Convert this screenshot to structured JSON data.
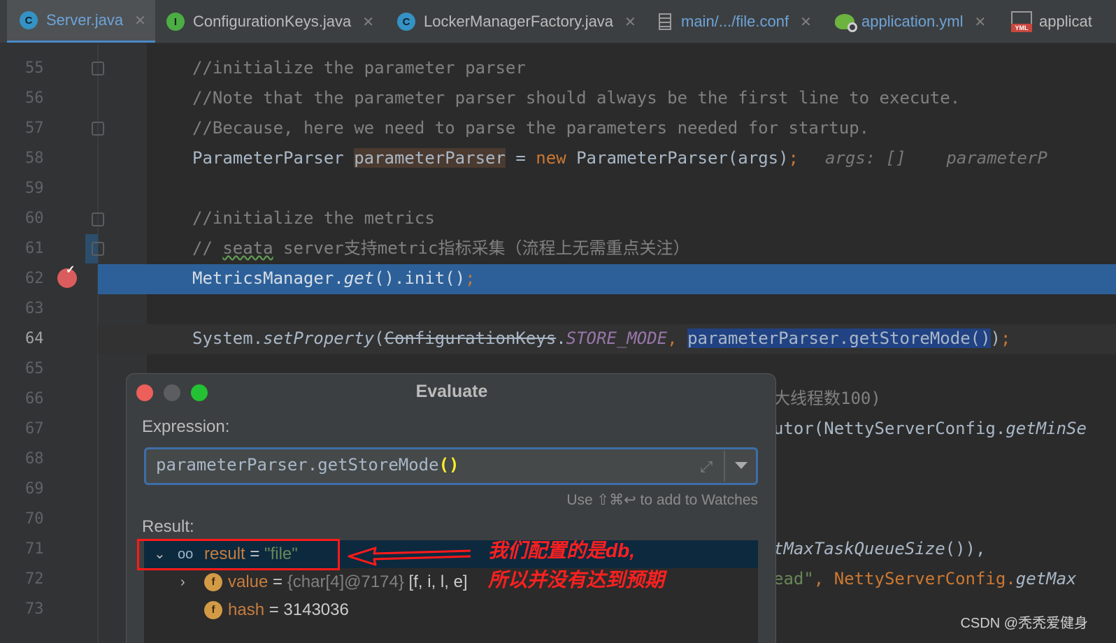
{
  "tabs": [
    {
      "label": "Server.java",
      "icon": "C",
      "icon_name": "class-icon",
      "active": true
    },
    {
      "label": "ConfigurationKeys.java",
      "icon": "I",
      "icon_name": "interface-icon"
    },
    {
      "label": "LockerManagerFactory.java",
      "icon": "C",
      "icon_name": "class-icon"
    },
    {
      "label": "main/.../file.conf",
      "icon_name": "text-file-icon"
    },
    {
      "label": "application.yml",
      "icon_name": "spring-config-icon"
    },
    {
      "label": "applicat",
      "icon_name": "yml-file-icon"
    }
  ],
  "line_numbers": [
    "55",
    "56",
    "57",
    "58",
    "59",
    "60",
    "61",
    "62",
    "63",
    "64",
    "65",
    "66",
    "67",
    "68",
    "69",
    "70",
    "71",
    "72",
    "73"
  ],
  "code": {
    "l55": "//initialize the parameter parser",
    "l56": "//Note that the parameter parser should always be the first line to execute.",
    "l57": "//Because, here we need to parse the parameters needed for startup.",
    "l58_type": "ParameterParser ",
    "l58_var": "parameterParser",
    "l58_eq": " = ",
    "l58_new": "new",
    "l58_ctor": " ParameterParser(args)",
    "l58_semi": ";",
    "l58_hint": "args: []    parameterP",
    "l60": "//initialize the metrics",
    "l61_a": "// ",
    "l61_b": "seata",
    "l61_c": " server支持metric指标采集（流程上无需重点关注）",
    "l62_a": "MetricsManager.",
    "l62_b": "get",
    "l62_c": "().init()",
    "l62_d": ";",
    "l64_a": "System.",
    "l64_b": "setProperty",
    "l64_c": "(",
    "l64_d": "ConfigurationKeys",
    "l64_e": ".",
    "l64_f": "STORE_MODE",
    "l64_g": ", ",
    "l64_h": "parameterParser.getStoreMode()",
    "l64_i": ")",
    "l64_j": ";",
    "l66_tail": "大线程数100)",
    "l67_tail_a": "utor(NettyServerConfig.",
    "l67_tail_b": "getMinSe",
    "l71_tail_a": "tMaxTaskQueueSize",
    "l71_tail_b": "()),",
    "l72_tail_a": "ead\"",
    "l72_tail_b": ", NettyServerConfig.",
    "l72_tail_c": "getMax"
  },
  "dialog": {
    "title": "Evaluate",
    "expression_label": "Expression:",
    "expression_text": "parameterParser.getStoreMode",
    "expression_parens": "()",
    "watch_hint": "Use ⇧⌘↩ to add to Watches",
    "result_label": "Result:",
    "result_name": "result",
    "result_eq": " = ",
    "result_value": "\"file\"",
    "value_name": "value",
    "value_eq": " = ",
    "value_ref": "{char[4]@7174}",
    "value_chars": " [f, i, l, e]",
    "hash_name": "hash",
    "hash_eq": " = ",
    "hash_value": "3143036"
  },
  "annotation": {
    "line1": "我们配置的是db,",
    "line2": "所以并没有达到预期"
  },
  "watermark": "CSDN @秃秃爱健身",
  "colors": {
    "selection_blue": "#2d6099",
    "annotation_red": "#ff2020",
    "traffic_close": "#ec5f5a",
    "traffic_min": "#5b5d5f",
    "traffic_max": "#25c134"
  }
}
